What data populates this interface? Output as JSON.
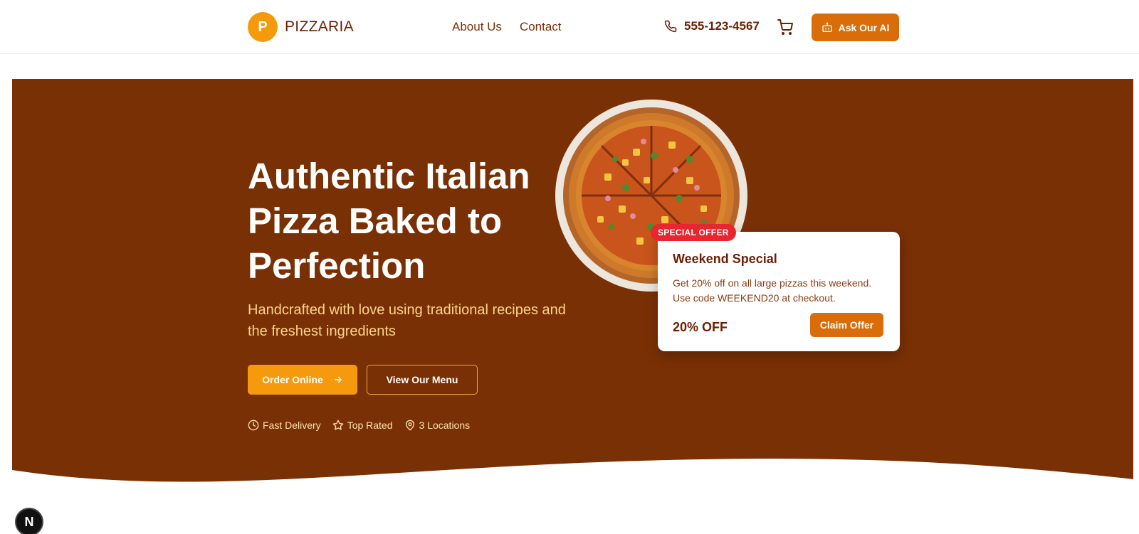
{
  "header": {
    "logo_letter": "P",
    "brand": "PIZZARIA",
    "nav": [
      {
        "label": "About Us"
      },
      {
        "label": "Contact"
      }
    ],
    "phone": "555-123-4567",
    "ai_button": "Ask Our AI"
  },
  "hero": {
    "title": "Authentic Italian Pizza Baked to Perfection",
    "subtitle": "Handcrafted with love using traditional recipes and the freshest ingredients",
    "order_button": "Order Online",
    "menu_button": "View Our Menu",
    "features": [
      {
        "icon": "clock-icon",
        "label": "Fast Delivery"
      },
      {
        "icon": "star-icon",
        "label": "Top Rated"
      },
      {
        "icon": "map-pin-icon",
        "label": "3 Locations"
      }
    ]
  },
  "offer": {
    "badge": "SPECIAL OFFER",
    "title": "Weekend Special",
    "text": "Get 20% off on all large pizzas this weekend. Use code WEEKEND20 at checkout.",
    "discount": "20% OFF",
    "button": "Claim Offer"
  },
  "dev_badge": "N",
  "colors": {
    "hero_bg": "#7a3005",
    "accent": "#f59a0c",
    "accent_dark": "#d86d09",
    "badge_red": "#e8262f",
    "subtitle": "#fcd58a"
  }
}
